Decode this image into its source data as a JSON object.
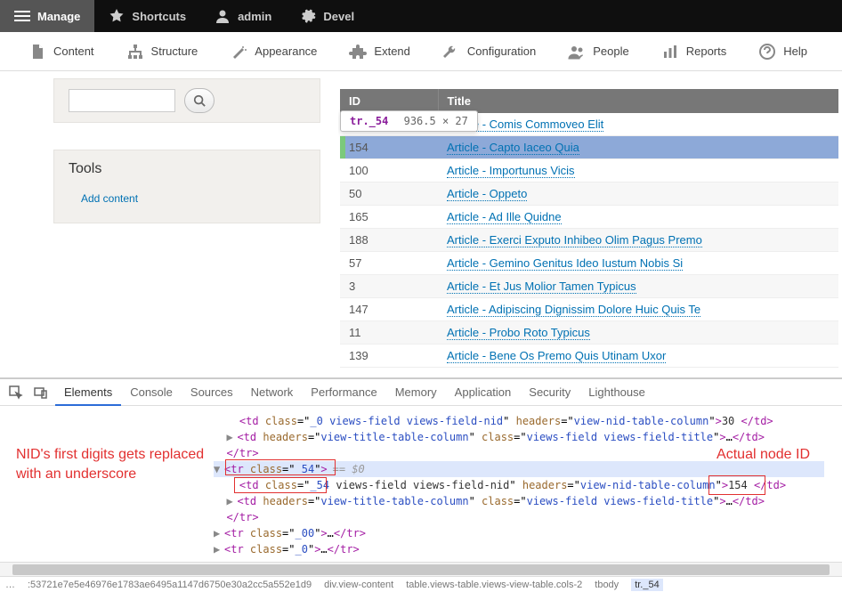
{
  "topbar": {
    "manage": "Manage",
    "shortcuts": "Shortcuts",
    "user": "admin",
    "devel": "Devel"
  },
  "adminmenu": {
    "content": "Content",
    "structure": "Structure",
    "appearance": "Appearance",
    "extend": "Extend",
    "configuration": "Configuration",
    "people": "People",
    "reports": "Reports",
    "help": "Help"
  },
  "sidebar": {
    "tools_heading": "Tools",
    "add_content": "Add content"
  },
  "tooltip": {
    "selector": "tr._54",
    "dimensions": "936.5 × 27"
  },
  "table": {
    "headers": {
      "id": "ID",
      "title": "Title"
    },
    "rows": [
      {
        "id": "",
        "title": "Article - Comis Commoveo Elit"
      },
      {
        "id": "154",
        "title": "Article - Capto Iaceo Quia",
        "highlight": true
      },
      {
        "id": "100",
        "title": "Article - Importunus Vicis"
      },
      {
        "id": "50",
        "title": "Article - Oppeto"
      },
      {
        "id": "165",
        "title": "Article - Ad Ille Quidne"
      },
      {
        "id": "188",
        "title": "Article - Exerci Exputo Inhibeo Olim Pagus Premo"
      },
      {
        "id": "57",
        "title": "Article - Gemino Genitus Ideo Iustum Nobis Si"
      },
      {
        "id": "3",
        "title": "Article - Et Jus Molior Tamen Typicus"
      },
      {
        "id": "147",
        "title": "Article - Adipiscing Dignissim Dolore Huic Quis Te"
      },
      {
        "id": "11",
        "title": "Article - Probo Roto Typicus"
      },
      {
        "id": "139",
        "title": "Article - Bene Os Premo Quis Utinam Uxor"
      }
    ]
  },
  "devtools": {
    "tabs": [
      "Elements",
      "Console",
      "Sources",
      "Network",
      "Performance",
      "Memory",
      "Application",
      "Security",
      "Lighthouse"
    ],
    "active_tab": 0,
    "code": {
      "l1_class": "_0 views-field views-field-nid",
      "l1_headers": "view-nid-table-column",
      "l1_text": "30 ",
      "l2_headers": "view-title-table-column",
      "l2_class": "views-field views-field-title",
      "tr_class": "_54",
      "eq": "== $0",
      "td_class": "_54",
      "td_rest": " views-field views-field-nid",
      "td_headers": "view-nid-table-column",
      "td_text": "154 ",
      "l5_headers": "view-title-table-column",
      "l5_class": "views-field views-field-title",
      "tr2_class": "_00",
      "tr3_class": "_0"
    },
    "breadcrumb": [
      "…",
      ":53721e7e5e46976e1783ae6495a1147d6750e30a2cc5a552e1d9",
      "div.view-content",
      "table.views-table.views-view-table.cols-2",
      "tbody",
      "tr._54"
    ]
  },
  "annotations": {
    "left": "NID's first digits gets replaced with an underscore",
    "right": "Actual node ID"
  }
}
